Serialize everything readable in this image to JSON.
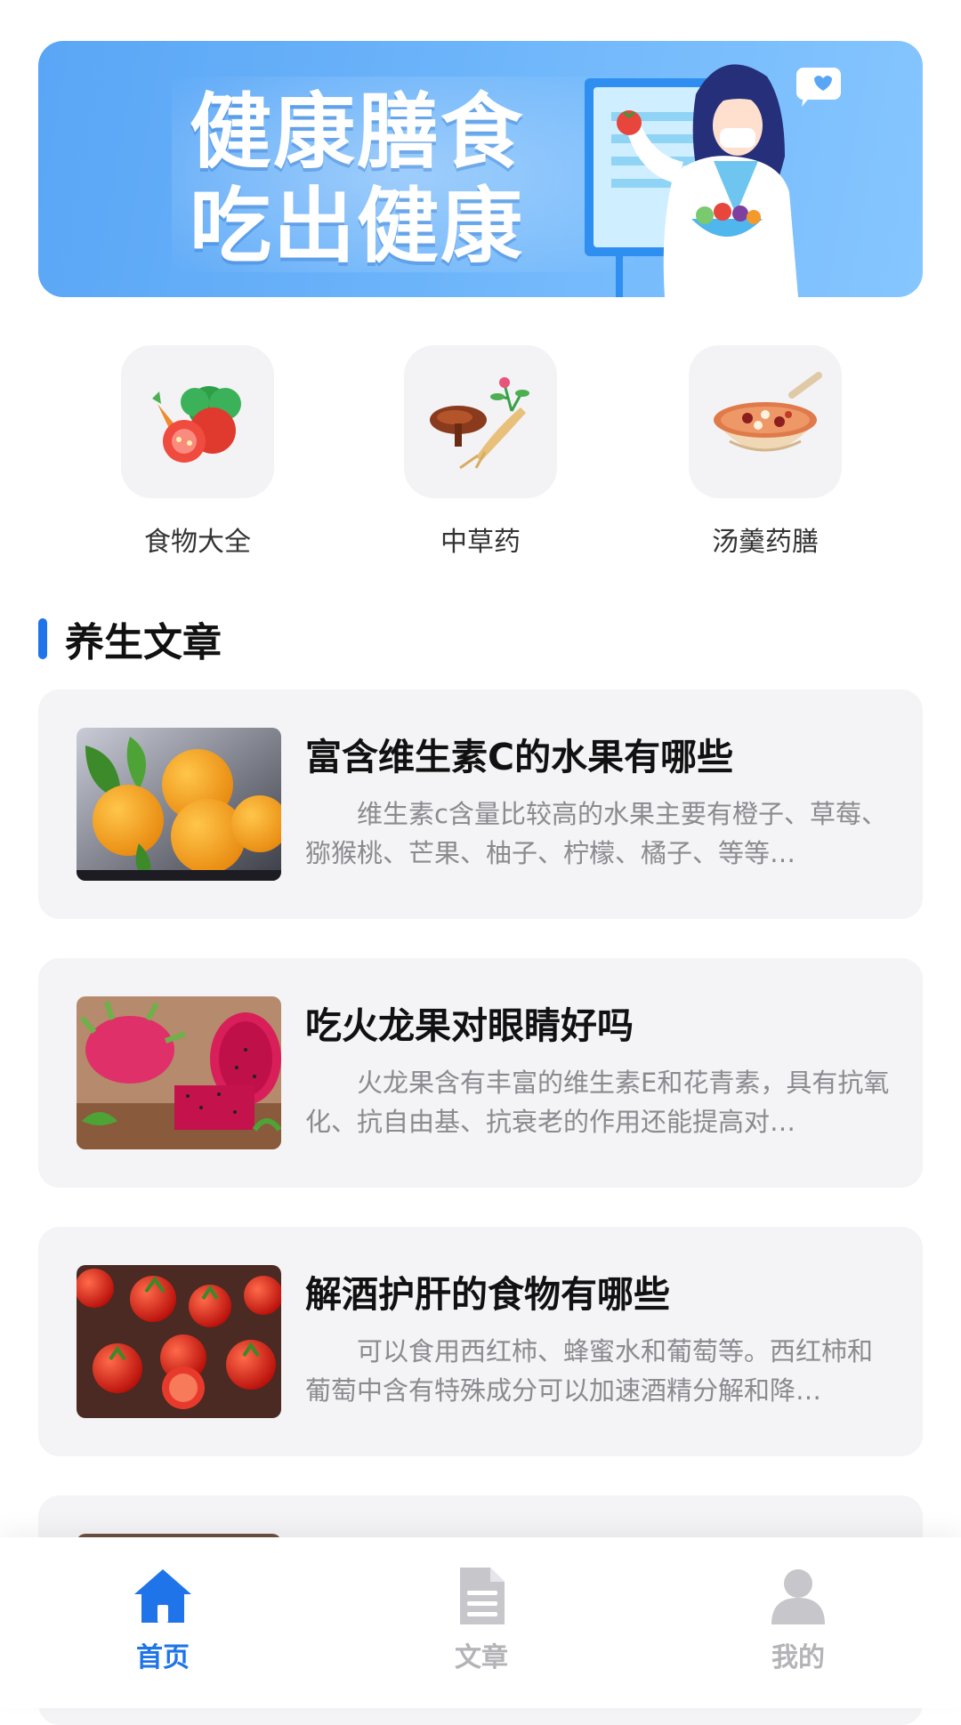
{
  "banner": {
    "line1": "健康膳食",
    "line2": "吃出健康"
  },
  "categories": [
    {
      "label": "食物大全",
      "icon": "vegetables-icon"
    },
    {
      "label": "中草药",
      "icon": "herbal-medicine-icon"
    },
    {
      "label": "汤羹药膳",
      "icon": "soup-bowl-icon"
    }
  ],
  "section": {
    "title": "养生文章"
  },
  "articles": [
    {
      "title": "富含维生素C的水果有哪些",
      "desc": "维生素c含量比较高的水果主要有橙子、草莓、猕猴桃、芒果、柚子、柠檬、橘子、等等…",
      "image": "oranges-photo"
    },
    {
      "title": "吃火龙果对眼睛好吗",
      "desc": "火龙果含有丰富的维生素E和花青素，具有抗氧化、抗自由基、抗衰老的作用还能提高对…",
      "image": "dragon-fruit-photo"
    },
    {
      "title": "解酒护肝的食物有哪些",
      "desc": "可以食用西红柿、蜂蜜水和葡萄等。西红柿和葡萄中含有特殊成分可以加速酒精分解和降…",
      "image": "tomatoes-photo"
    }
  ],
  "tabbar": {
    "tabs": [
      {
        "label": "首页",
        "icon": "home-icon",
        "active": true
      },
      {
        "label": "文章",
        "icon": "document-icon",
        "active": false
      },
      {
        "label": "我的",
        "icon": "user-icon",
        "active": false
      }
    ],
    "active_color": "#1e74e8",
    "inactive_color": "#b3b3b8"
  }
}
